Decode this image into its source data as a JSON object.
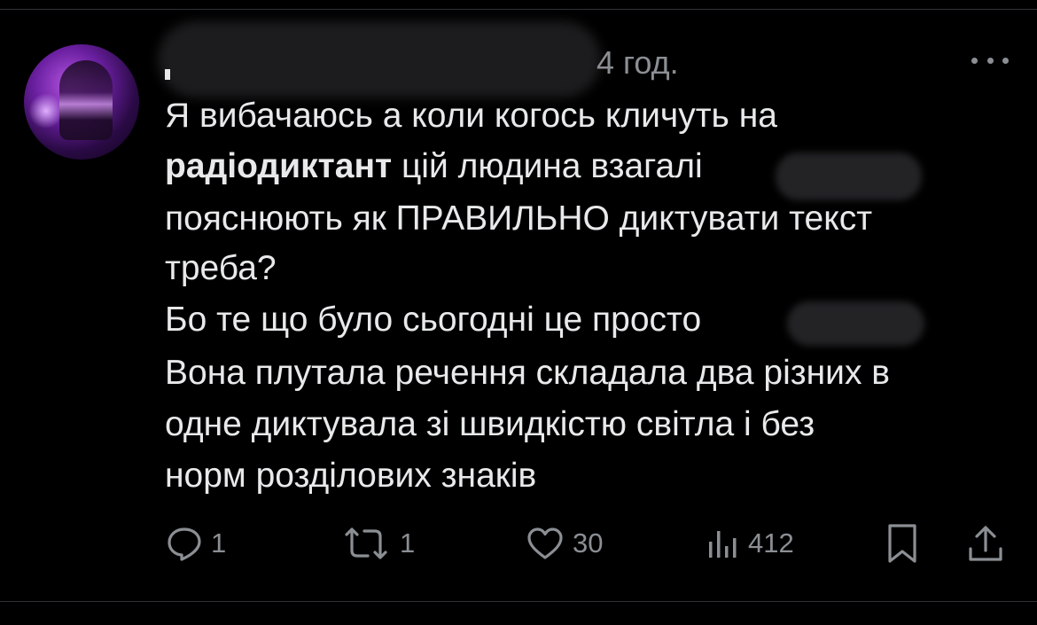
{
  "post": {
    "timestamp": "4 год.",
    "lines": [
      "Я вибачаюсь а коли когось кличуть на",
      "радіодиктант",
      " цій людина взагалі",
      "пояснюють як ПРАВИЛЬНО диктувати текст",
      "треба?",
      "Бо те що було сьогодні це просто",
      "Вона плутала речення складала два різних в",
      "одне диктувала зі швидкістю світла і без",
      "норм розділових знаків"
    ]
  },
  "actions": {
    "reply_count": "1",
    "retweet_count": "1",
    "like_count": "30",
    "views_count": "412"
  },
  "icons": {
    "more": "more-horizontal-icon",
    "reply": "reply-icon",
    "retweet": "retweet-icon",
    "like": "heart-icon",
    "views": "views-icon",
    "bookmark": "bookmark-icon",
    "share": "share-icon"
  },
  "colors": {
    "background": "#000000",
    "text": "#e7e9ea",
    "muted": "#8b8f94",
    "divider": "#2f3336"
  }
}
